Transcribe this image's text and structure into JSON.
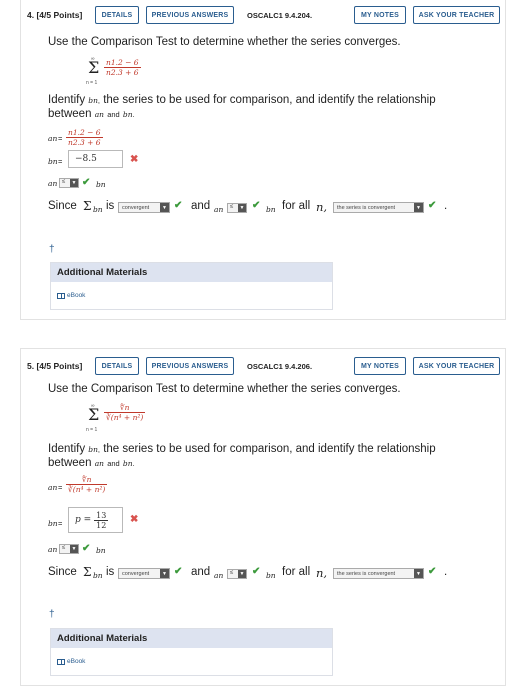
{
  "header_buttons": {
    "details": "DETAILS",
    "previous_answers": "PREVIOUS ANSWERS",
    "my_notes": "MY NOTES",
    "ask_teacher": "ASK YOUR TEACHER"
  },
  "q1": {
    "number": "4.",
    "points": "[4/5 Points]",
    "code": "OSCALC1 9.4.204.",
    "prompt": "Use the Comparison Test to determine whether the series converges.",
    "series_top": "∞",
    "series_bottom": "n = 1",
    "an_num": "n1.2 − 6",
    "an_den": "n2.3 + 6",
    "identify_line1_a": "Identify",
    "identify_line1_b": "the series to be used for comparison, and identify the relationship",
    "identify_line2": "between",
    "identify_and": "and",
    "bn_label": "bn",
    "an_label": "an",
    "eq": "=",
    "bn_value": "−8.5",
    "rel_select": "≤",
    "since_label": "Since",
    "is_label": "is",
    "conv_select": "convergent",
    "and_label": "and",
    "forall_label": "for all",
    "n_label": "n,",
    "conclusion_select": "the series is convergent",
    "period": ".",
    "dagger": "†",
    "additional_materials": "Additional Materials",
    "ebook": "eBook"
  },
  "q2": {
    "number": "5.",
    "points": "[4/5 Points]",
    "code": "OSCALC1 9.4.206.",
    "prompt": "Use the Comparison Test to determine whether the series converges.",
    "series_top": "∞",
    "series_bottom": "n = 1",
    "an_num": "∜n",
    "an_den": "∛(n⁴ + n²)",
    "identify_line1_a": "Identify",
    "identify_line1_b": "the series to be used for comparison, and identify the relationship",
    "identify_line2": "between",
    "identify_and": "and",
    "bn_label": "bn",
    "an_label": "an",
    "eq": "=",
    "bn_value_p": "p =",
    "bn_value_num": "13",
    "bn_value_den": "12",
    "rel_select": "≤",
    "since_label": "Since",
    "is_label": "is",
    "conv_select": "convergent",
    "and_label": "and",
    "forall_label": "for all",
    "n_label": "n,",
    "conclusion_select": "the series is convergent",
    "period": ".",
    "dagger": "†",
    "additional_materials": "Additional Materials",
    "ebook": "eBook"
  }
}
